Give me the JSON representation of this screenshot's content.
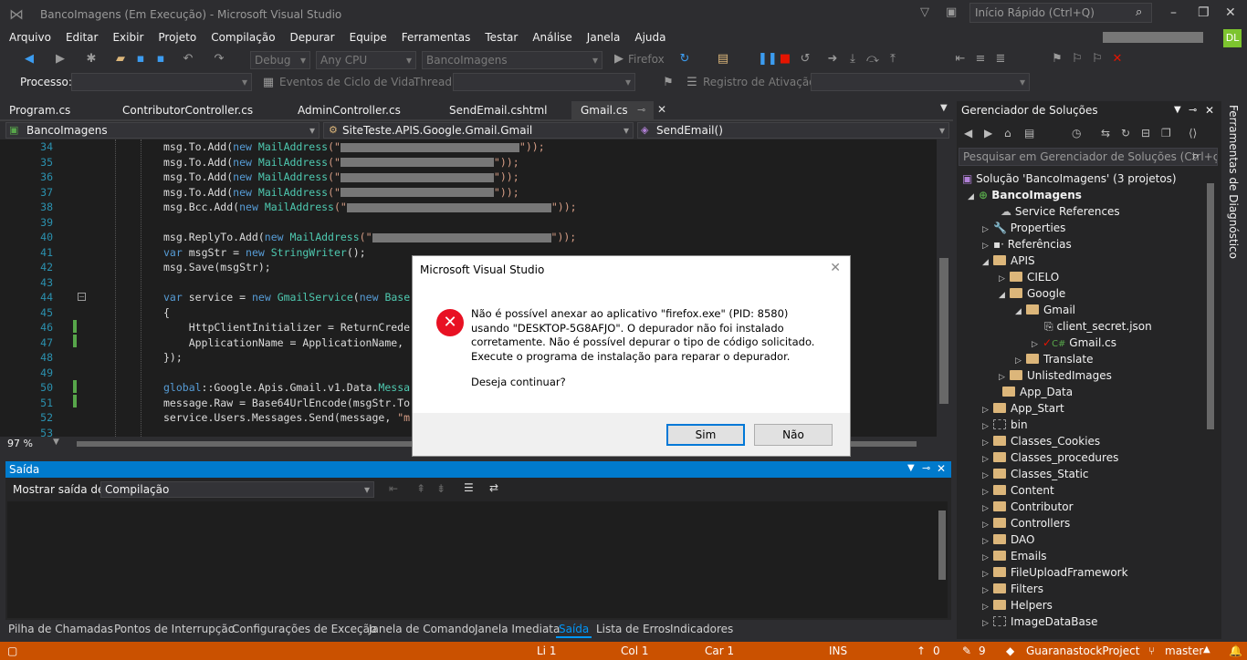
{
  "window": {
    "title": "BancoImagens (Em Execução) - Microsoft Visual Studio",
    "quick_launch_placeholder": "Início Rápido (Ctrl+Q)",
    "user_initials": "DL"
  },
  "menu": [
    "Arquivo",
    "Editar",
    "Exibir",
    "Projeto",
    "Compilação",
    "Depurar",
    "Equipe",
    "Ferramentas",
    "Testar",
    "Análise",
    "Janela",
    "Ajuda"
  ],
  "toolbar": {
    "config": "Debug",
    "platform": "Any CPU",
    "startup_project": "BancoImagens",
    "browser": "Firefox"
  },
  "toolbar2": {
    "process_label": "Processo:",
    "lifecycle_label": "Eventos de Ciclo de Vida",
    "thread_label": "Thread:",
    "activation_label": "Registro de Ativação:"
  },
  "doc_tabs": [
    "Program.cs",
    "ContributorController.cs",
    "AdminController.cs",
    "SendEmail.cshtml",
    "Gmail.cs"
  ],
  "navbar": {
    "project": "BancoImagens",
    "class": "SiteTeste.APIS.Google.Gmail.Gmail",
    "member": "SendEmail()"
  },
  "code": {
    "line_numbers": [
      "34",
      "35",
      "36",
      "37",
      "38",
      "39",
      "40",
      "41",
      "42",
      "43",
      "44",
      "45",
      "46",
      "47",
      "48",
      "49",
      "50",
      "51",
      "52",
      "53"
    ],
    "lines": {
      "l34a": "msg.To.Add(",
      "l35a": "msg.To.Add(",
      "l36a": "msg.To.Add(",
      "l37a": "msg.To.Add(",
      "l38a": "msg.Bcc.Add(",
      "l40a": "msg.ReplyTo.Add(",
      "l41": "msgStr = ",
      "l41b": "StringWriter",
      "l41c": "();",
      "l42": "msg.Save(msgStr);",
      "l44a": "service = ",
      "l44b": "GmailService",
      "l44c": "(",
      "l44d": "Base",
      "l45": "{",
      "l46": "    HttpClientInitializer = ReturnCrede",
      "l47": "    ApplicationName = ApplicationName,",
      "l48": "});",
      "l50a": "global",
      "l50b": "::Google.Apis.Gmail.v1.Data.",
      "l51": "message.Raw = Base64UrlEncode(msgStr.To",
      "l52": "service.Users.Messages.Send(message, ",
      "l52s": "\"m",
      "kw_new": "new",
      "kw_var": "var",
      "tp_mail": "MailAddress",
      "str_open": "(\"",
      "str_close": "\"));",
      "l50c": "Messa"
    }
  },
  "zoom": "97 %",
  "output": {
    "title": "Saída",
    "show_label": "Mostrar saída de:",
    "source": "Compilação"
  },
  "bottom_tabs": [
    "Pilha de Chamadas",
    "Pontos de Interrupção",
    "Configurações de Exceção",
    "Janela de Comando",
    "Janela Imediata",
    "Saída",
    "Lista de Erros",
    "Indicadores"
  ],
  "solution": {
    "title": "Gerenciador de Soluções",
    "search_placeholder": "Pesquisar em Gerenciador de Soluções (Ctrl+ç)",
    "root": "Solução 'BancoImagens' (3 projetos)",
    "items": [
      {
        "label": "BancoImagens"
      },
      {
        "label": "Service References"
      },
      {
        "label": "Properties"
      },
      {
        "label": "Referências"
      },
      {
        "label": "APIS"
      },
      {
        "label": "CIELO"
      },
      {
        "label": "Google"
      },
      {
        "label": "Gmail"
      },
      {
        "label": "client_secret.json"
      },
      {
        "label": "Gmail.cs"
      },
      {
        "label": "Translate"
      },
      {
        "label": "UnlistedImages"
      },
      {
        "label": "App_Data"
      },
      {
        "label": "App_Start"
      },
      {
        "label": "bin"
      },
      {
        "label": "Classes_Cookies"
      },
      {
        "label": "Classes_procedures"
      },
      {
        "label": "Classes_Static"
      },
      {
        "label": "Content"
      },
      {
        "label": "Contributor"
      },
      {
        "label": "Controllers"
      },
      {
        "label": "DAO"
      },
      {
        "label": "Emails"
      },
      {
        "label": "FileUploadFramework"
      },
      {
        "label": "Filters"
      },
      {
        "label": "Helpers"
      },
      {
        "label": "ImageDataBase"
      }
    ]
  },
  "side_strip": "Ferramentas de Diagnóstico",
  "dialog": {
    "title": "Microsoft Visual Studio",
    "message": "Não é possível anexar ao aplicativo \"firefox.exe\" (PID: 8580) usando \"DESKTOP-5G8AFJO\". O depurador não foi instalado corretamente. Não é possível depurar o tipo de código solicitado. Execute o programa de instalação para reparar o depurador.",
    "question": "Deseja continuar?",
    "yes": "Sim",
    "no": "Não"
  },
  "status": {
    "line": "Li 1",
    "col": "Col 1",
    "char": "Car 1",
    "mode": "INS",
    "up": "0",
    "pending": "9",
    "repo": "GuaranastockProject",
    "branch": "master"
  },
  "colors": {
    "accent": "#007acc",
    "status_bar": "#ca5100",
    "error": "#e81123"
  }
}
